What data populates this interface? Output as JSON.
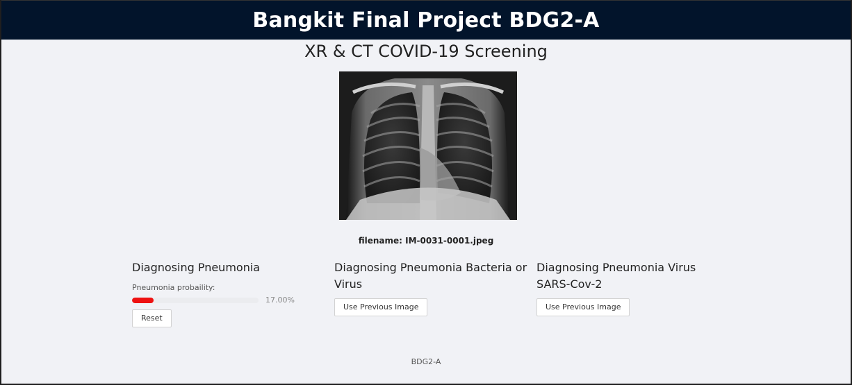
{
  "header": {
    "title": "Bangkit Final Project BDG2-A"
  },
  "subtitle": "XR & CT COVID-19 Screening",
  "image": {
    "filename_text": "filename: IM-0031-0001.jpeg"
  },
  "panels": [
    {
      "title": "Diagnosing Pneumonia",
      "probability_label": "Pneumonia probaility:",
      "probability_value": "17.00%",
      "probability_fraction": 0.17,
      "button_label": "Reset"
    },
    {
      "title": "Diagnosing Pneumonia Bacteria or Virus",
      "button_label": "Use Previous Image"
    },
    {
      "title": "Diagnosing Pneumonia Virus SARS-Cov-2",
      "button_label": "Use Previous Image"
    }
  ],
  "footer": {
    "text": "BDG2-A"
  },
  "colors": {
    "header_bg": "#02142b",
    "progress_fill": "#ee1111",
    "page_bg": "#f1f2f6"
  }
}
